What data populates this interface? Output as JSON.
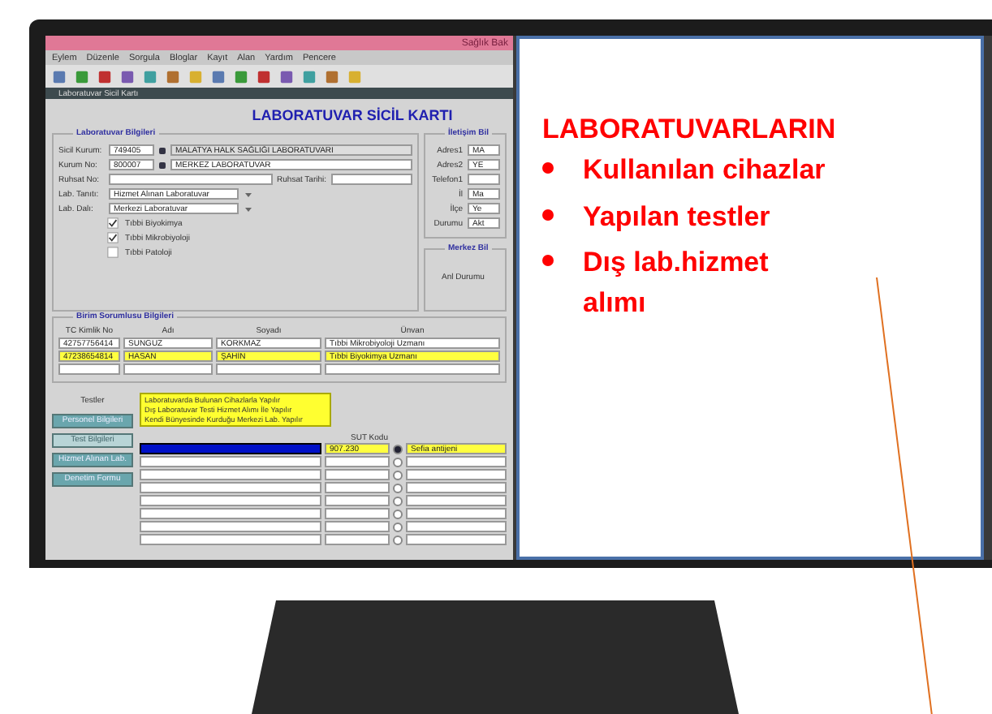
{
  "window": {
    "title": "Sağlık Bak",
    "menu": [
      "Eylem",
      "Düzenle",
      "Sorgula",
      "Bloglar",
      "Kayıt",
      "Alan",
      "Yardım",
      "Pencere"
    ],
    "subwindow_title": "Laboratuvar Sicil Kartı",
    "heading": "LABORATUVAR SİCİL KARTI"
  },
  "lab_info": {
    "title": "Laboratuvar Bilgileri",
    "fields": [
      {
        "label": "Sicil Kurum:",
        "code": "749405",
        "value": "MALATYA HALK SAĞLIĞI LABORATUVARI"
      },
      {
        "label": "Kurum No:",
        "code": "800007",
        "value": "MERKEZ LABORATUVAR"
      },
      {
        "label": "Ruhsat No:",
        "extra_label": "Ruhsat Tarihi:"
      },
      {
        "label": "Lab. Tanıtı:",
        "value": "Hizmet Alınan Laboratuvar",
        "kind": "select"
      },
      {
        "label": "Lab. Dalı:",
        "value": "Merkezi Laboratuvar",
        "kind": "select"
      }
    ],
    "checkboxes": [
      {
        "label": "Tıbbi Biyokimya",
        "checked": true
      },
      {
        "label": "Tıbbi Mikrobiyoloji",
        "checked": true
      },
      {
        "label": "Tıbbi Patoloji",
        "checked": false
      }
    ]
  },
  "contact": {
    "title": "İletişim Bil",
    "fields": [
      {
        "label": "Adres1",
        "value": "MA"
      },
      {
        "label": "Adres2",
        "value": "YE"
      },
      {
        "label": "Telefon1"
      },
      {
        "label": "İl",
        "value": "Ma"
      },
      {
        "label": "İlçe",
        "value": "Ye"
      },
      {
        "label": "Durumu",
        "value": "Akt"
      }
    ],
    "center_title": "Merkez Bil",
    "center_label": "Anl Durumu"
  },
  "staff": {
    "title": "Birim Sorumlusu Bilgileri",
    "columns": [
      "TC Kimlik No",
      "Adı",
      "Soyadı",
      "Ünvan"
    ],
    "rows": [
      {
        "cells": [
          "42757756414",
          "SUNGUZ",
          "KORKMAZ",
          "Tıbbi Mikrobiyoloji Uzmanı"
        ],
        "selected": false
      },
      {
        "cells": [
          "47238654814",
          "HASAN",
          "ŞAHİN",
          "Tıbbi Biyokimya Uzmanı"
        ],
        "selected": true
      },
      {
        "cells": [
          "",
          "",
          "",
          ""
        ],
        "selected": false
      }
    ]
  },
  "side_title": "Testler",
  "side_buttons": [
    {
      "label": "Personel Bilgileri",
      "selected": false
    },
    {
      "label": "Test Bilgileri",
      "selected": true
    },
    {
      "label": "Hizmet Alınan Lab.",
      "selected": false
    },
    {
      "label": "Denetim Formu",
      "selected": false
    }
  ],
  "dropdown_options": [
    "Laboratuvarda Bulunan Cihazlarla Yapılır",
    "Dış Laboratuvar Testi Hizmet Alımı İle Yapılır",
    "Kendi Bünyesinde Kurduğu Merkezi Lab. Yapılır"
  ],
  "tests": {
    "code_header": "SUT Kodu",
    "rows": [
      {
        "code": "907.230",
        "name": "Sefia antijeni",
        "selected": true
      },
      {
        "selected": false
      },
      {
        "selected": false
      },
      {
        "selected": false
      },
      {
        "selected": false
      },
      {
        "selected": false
      },
      {
        "selected": false
      },
      {
        "selected": false
      }
    ]
  },
  "callout": {
    "heading": "LABORATUVARLARIN",
    "bullets": [
      "Kullanılan cihazlar",
      "Yapılan testler",
      "Dış lab.hizmet alımı"
    ]
  }
}
